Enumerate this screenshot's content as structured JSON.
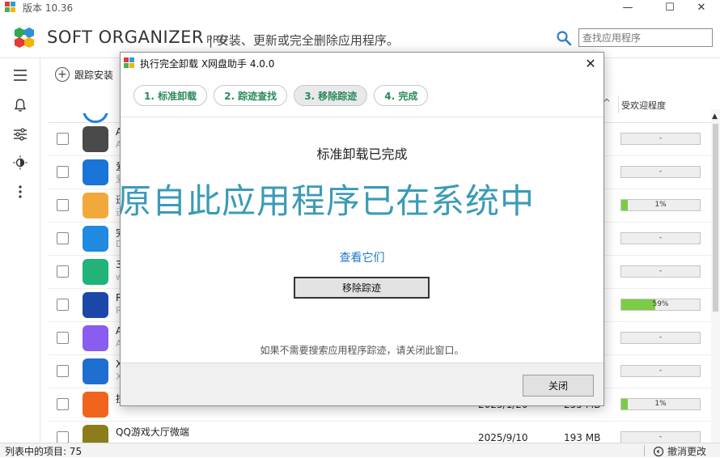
{
  "window": {
    "version_label": "版本 10.36",
    "minimize_glyph": "—",
    "maximize_glyph": "☐",
    "close_glyph": "✕"
  },
  "header": {
    "brand": "SOFT ORGANIZER",
    "brand_suffix": "PRO",
    "tagline": "| 安装、更新或完全删除应用程序。",
    "search_placeholder": "查找应用程序",
    "search_icon": "search-icon"
  },
  "sidebar": {
    "icons": [
      "menu-icon",
      "bell-icon",
      "sliders-icon",
      "theme-icon",
      "more-icon"
    ]
  },
  "toolbar": {
    "track_install_label": "跟踪安装",
    "sort_glyph": "^",
    "popularity_header": "受欢迎程度"
  },
  "rows": [
    {
      "name": "A",
      "sub": "A",
      "date": "",
      "size": "",
      "popularity": "-",
      "popularity_pct": 0,
      "icon_color": "#4a4a4a"
    },
    {
      "name": "爱",
      "sub": "爱",
      "date": "",
      "size": "",
      "popularity": "-",
      "popularity_pct": 0,
      "icon_color": "#1a73d6"
    },
    {
      "name": "迅",
      "sub": "迅",
      "date": "",
      "size": "",
      "popularity": "1%",
      "popularity_pct": 1,
      "icon_color": "#f2a93b"
    },
    {
      "name": "完",
      "sub": "D",
      "date": "",
      "size": "",
      "popularity": "-",
      "popularity_pct": 0,
      "icon_color": "#1f8ae0"
    },
    {
      "name": "3",
      "sub": "w",
      "date": "",
      "size": "",
      "popularity": "-",
      "popularity_pct": 0,
      "icon_color": "#22b37a"
    },
    {
      "name": "R",
      "sub": "R",
      "date": "",
      "size": "",
      "popularity": "59%",
      "popularity_pct": 59,
      "icon_color": "#1b47a8"
    },
    {
      "name": "A",
      "sub": "A",
      "date": "",
      "size": "",
      "popularity": "-",
      "popularity_pct": 0,
      "icon_color": "#8a5cf0"
    },
    {
      "name": "X",
      "sub": "X",
      "date": "",
      "size": "",
      "popularity": "-",
      "popularity_pct": 0,
      "icon_color": "#1f6fd0"
    },
    {
      "name": "搜",
      "sub": "",
      "date": "2025/1/20",
      "size": "255 MB",
      "popularity": "1%",
      "popularity_pct": 1,
      "icon_color": "#f0641e"
    },
    {
      "name": "QQ游戏大厅微端",
      "sub": "",
      "date": "2025/9/10",
      "size": "193 MB",
      "popularity": "-",
      "popularity_pct": 0,
      "icon_color": "#8a7d1a"
    }
  ],
  "statusbar": {
    "items_label": "列表中的项目: 75",
    "undo_label": "撤消更改"
  },
  "dialog": {
    "title": "执行完全卸载  X网盘助手 4.0.0",
    "close_glyph": "✕",
    "steps": [
      "1. 标准卸载",
      "2. 踪迹查找",
      "3. 移除踪迹",
      "4. 完成"
    ],
    "active_step": 2,
    "heading": "标准卸载已完成",
    "banner": "原自此应用程序已在系统中",
    "view_link": "查看它们",
    "remove_button": "移除踪迹",
    "hint": "如果不需要搜索应用程序踪迹，请关闭此窗口。",
    "close_button": "关闭"
  }
}
